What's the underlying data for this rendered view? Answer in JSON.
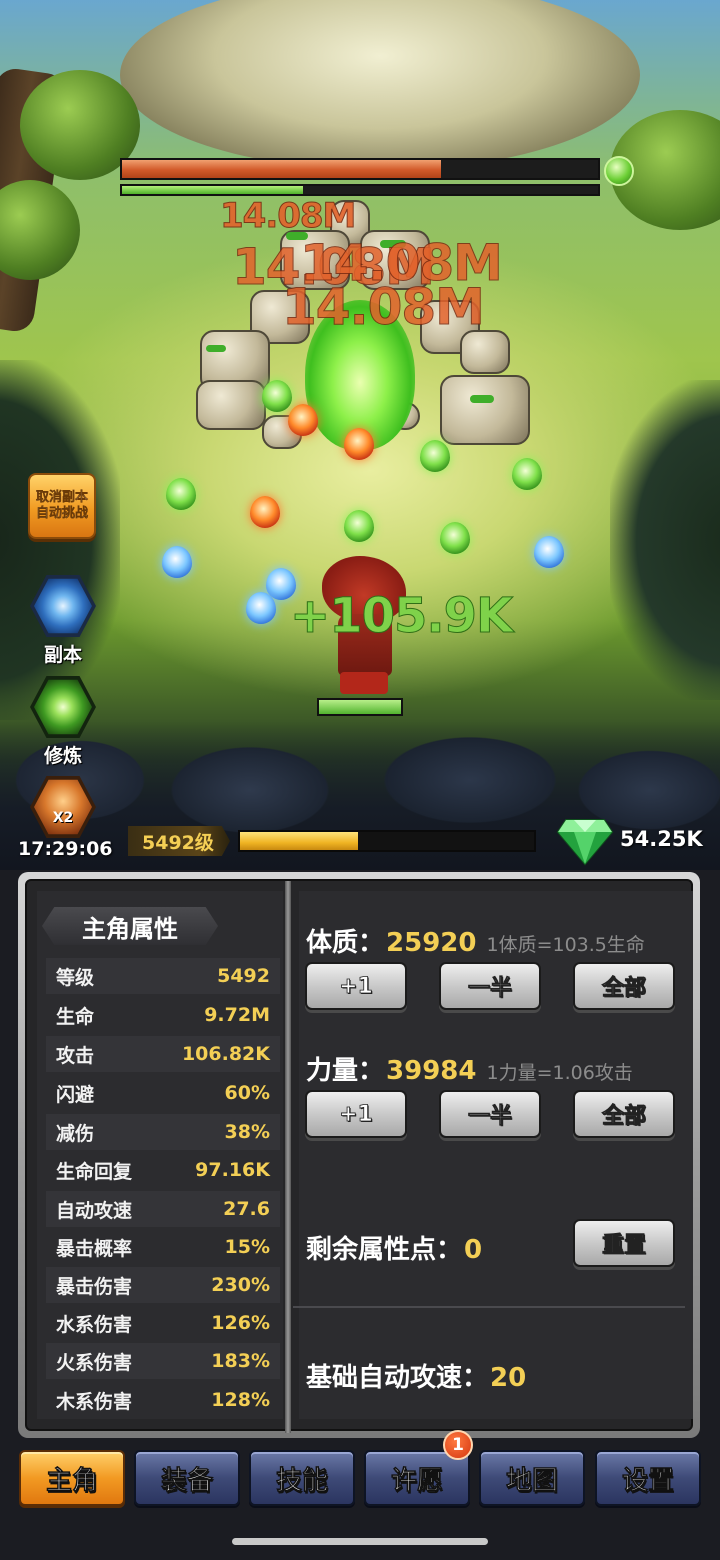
{
  "battle": {
    "damage_numbers": [
      "14.08M",
      "14.08M",
      "14.08M",
      "14.08M"
    ],
    "heal_number": "+105.9K",
    "boss_hp_fraction": 0.67,
    "boss_shield_fraction": 0.38
  },
  "side_buttons": {
    "cancel_auto_line1": "取消副本",
    "cancel_auto_line2": "自动挑战",
    "dungeon_label": "副本",
    "cultivate_label": "修炼",
    "double_badge": "X2",
    "timer": "17:29:06"
  },
  "status_bar": {
    "level": "5492级",
    "xp_fraction": 0.4,
    "gems": "54.25K"
  },
  "stats": {
    "title": "主角属性",
    "rows": [
      {
        "name": "等级",
        "value": "5492"
      },
      {
        "name": "生命",
        "value": "9.72M"
      },
      {
        "name": "攻击",
        "value": "106.82K"
      },
      {
        "name": "闪避",
        "value": "60%"
      },
      {
        "name": "减伤",
        "value": "38%"
      },
      {
        "name": "生命回复",
        "value": "97.16K"
      },
      {
        "name": "自动攻速",
        "value": "27.6"
      },
      {
        "name": "暴击概率",
        "value": "15%"
      },
      {
        "name": "暴击伤害",
        "value": "230%"
      },
      {
        "name": "水系伤害",
        "value": "126%"
      },
      {
        "name": "火系伤害",
        "value": "183%"
      },
      {
        "name": "木系伤害",
        "value": "128%"
      }
    ]
  },
  "attributes": {
    "constitution": {
      "label": "体质：",
      "value": "25920",
      "hint": "1体质=103.5生命"
    },
    "strength": {
      "label": "力量：",
      "value": "39984",
      "hint": "1力量=1.06攻击"
    },
    "buttons": {
      "plus_one": "+1",
      "half": "一半",
      "all": "全部"
    },
    "remaining_label": "剩余属性点：",
    "remaining_value": "0",
    "reset_label": "重置",
    "base_speed_label": "基础自动攻速：",
    "base_speed_value": "20"
  },
  "tabs": {
    "hero": "主角",
    "equipment": "装备",
    "skills": "技能",
    "wish": "许愿",
    "map": "地图",
    "settings": "设置",
    "wish_badge": "1"
  },
  "colors": {
    "accent_gold": "#f3cf55",
    "damage": "#e2632c",
    "heal": "#7fd24a",
    "tab_active": "#f29a23",
    "tab_inactive": "#3e4a77"
  }
}
